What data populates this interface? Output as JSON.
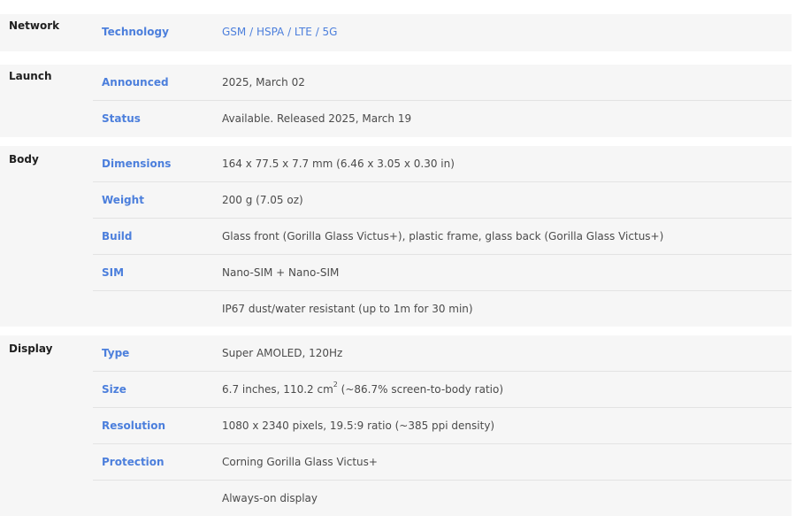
{
  "sections": [
    {
      "category": "Network",
      "rows": [
        {
          "label": "Technology",
          "value": "GSM / HSPA / LTE / 5G"
        }
      ]
    },
    {
      "category": "Launch",
      "rows": [
        {
          "label": "Announced",
          "value": "2025, March 02"
        },
        {
          "label": "Status",
          "value": "Available. Released 2025, March 19"
        }
      ]
    },
    {
      "category": "Body",
      "rows": [
        {
          "label": "Dimensions",
          "value": "164 x 77.5 x 7.7 mm (6.46 x 3.05 x 0.30 in)"
        },
        {
          "label": "Weight",
          "value": "200 g (7.05 oz)"
        },
        {
          "label": "Build",
          "value": "Glass front (Gorilla Glass Victus+), plastic frame, glass back (Gorilla Glass Victus+)"
        },
        {
          "label": "SIM",
          "value": "Nano-SIM + Nano-SIM"
        },
        {
          "label": "",
          "value": "IP67 dust/water resistant (up to 1m for 30 min)"
        }
      ]
    },
    {
      "category": "Display",
      "rows": [
        {
          "label": "Type",
          "value": "Super AMOLED, 120Hz"
        },
        {
          "label": "Size",
          "value_pre": "6.7 inches, 110.2 cm",
          "value_sup": "2",
          "value_post": " (~86.7% screen-to-body ratio)"
        },
        {
          "label": "Resolution",
          "value": "1080 x 2340 pixels, 19.5:9 ratio (~385 ppi density)"
        },
        {
          "label": "Protection",
          "value": "Corning Gorilla Glass Victus+"
        },
        {
          "label": "",
          "value": "Always-on display"
        }
      ]
    }
  ]
}
